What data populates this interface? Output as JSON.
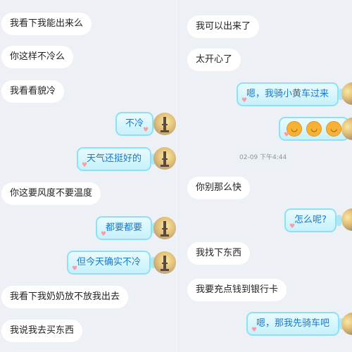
{
  "left_column": {
    "messages": [
      {
        "text": "我看下我能出来么"
      },
      {
        "text": "你这样不冷么"
      },
      {
        "text": "我看看貌冷"
      },
      {
        "text": "不冷"
      },
      {
        "text": "天气还挺好的"
      },
      {
        "text": "你这要风度不要温度"
      },
      {
        "text": "都要都要"
      },
      {
        "text": "但今天确实不冷"
      },
      {
        "text": "我看下我奶奶放不放我出去"
      },
      {
        "text": "我说我去买东西"
      }
    ]
  },
  "right_column": {
    "messages": [
      {
        "text": "我可以出来了"
      },
      {
        "text": "太开心了"
      },
      {
        "text": "嗯，我骑小黄车过来"
      },
      {
        "text": "😆😆😆"
      },
      {
        "text": "你别那么快"
      },
      {
        "text": "怎么呢?"
      },
      {
        "text": "我找下东西"
      },
      {
        "text": "我要充点钱到银行卡"
      },
      {
        "text": "嗯，那我先骑车吧"
      }
    ],
    "timestamp": "02-09 下午4:44"
  },
  "icons": {
    "heart": "heart-icon",
    "avatar": "eiffel-tower-avatar",
    "emoji": "laughing-face-emoji"
  },
  "colors": {
    "background": "#edf0f5",
    "bubble_white": "#ffffff",
    "jar_border": "#8ee1f5",
    "jar_text": "#1a78c8"
  }
}
